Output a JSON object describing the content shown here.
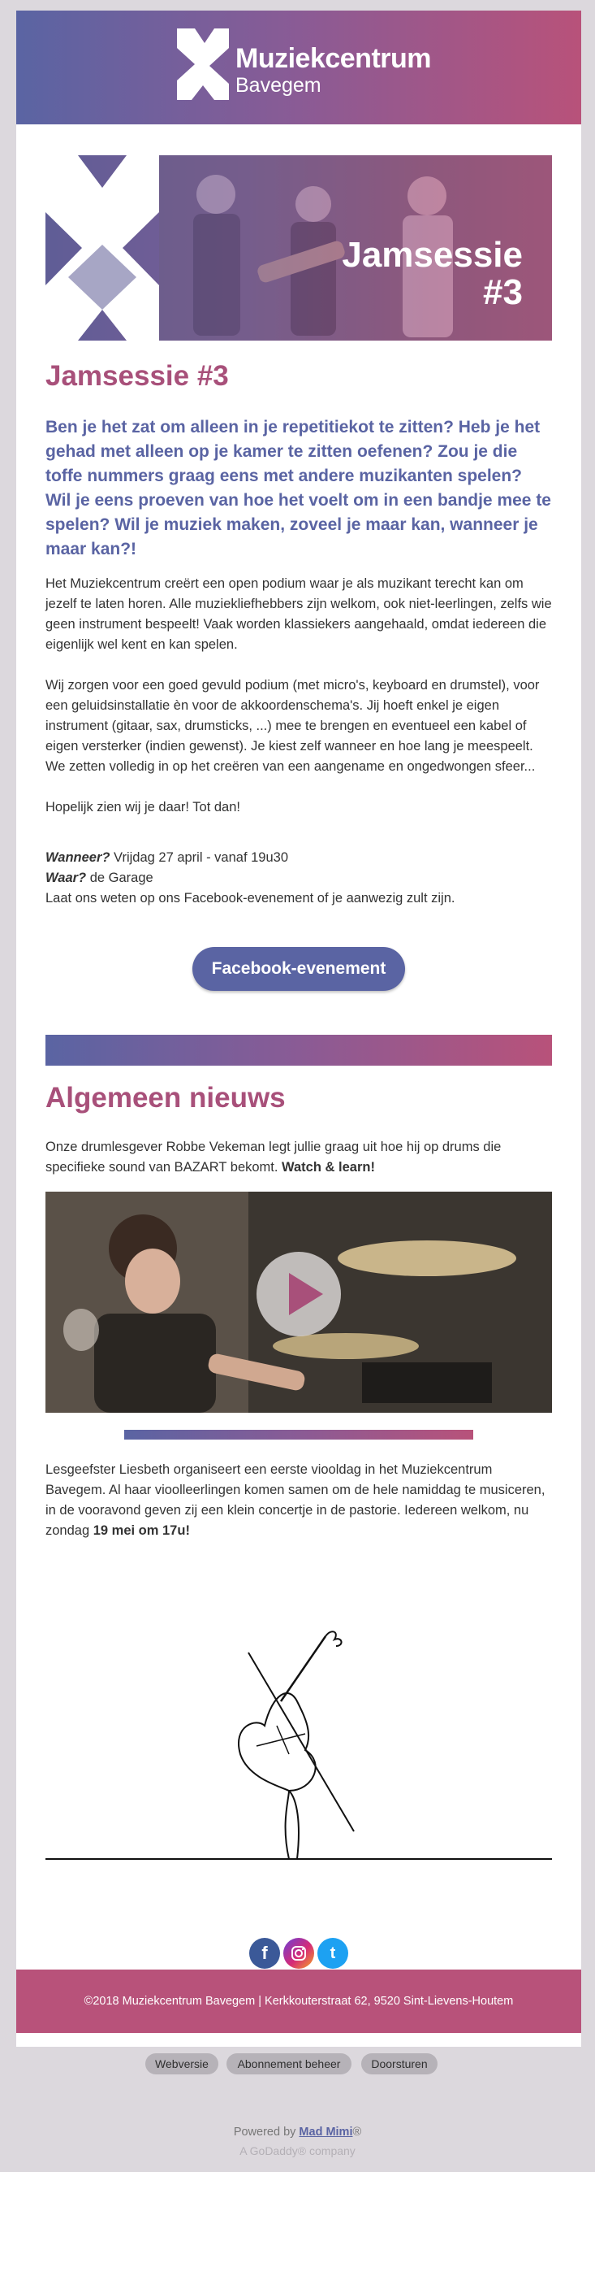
{
  "header": {
    "brand_line1": "Muziekcentrum",
    "brand_line2": "Bavegem"
  },
  "hero": {
    "title_line1": "Jamsessie",
    "title_line2": "#3"
  },
  "jam": {
    "heading": "Jamsessie #3",
    "lead": "Ben je het zat om alleen in je repetitiekot te zitten? Heb je het gehad met alleen op je kamer te zitten oefenen? Zou je die toffe nummers graag eens met andere muzikanten spelen? Wil je eens proeven van hoe het voelt om in een bandje mee te spelen? Wil je muziek maken, zoveel je maar kan, wanneer je maar kan?!",
    "para1": "Het Muziekcentrum creërt een open podium waar je als muzikant terecht kan om jezelf te laten horen. Alle muziekliefhebbers zijn welkom, ook niet-leerlingen, zelfs wie geen instrument bespeelt! Vaak worden klassiekers aangehaald, omdat iedereen die eigenlijk wel kent en kan spelen.",
    "para2": "Wij zorgen voor een goed gevuld podium (met micro's, keyboard en drumstel), voor een geluidsinstallatie èn voor de akkoordenschema's. Jij hoeft enkel je eigen instrument (gitaar, sax, drumsticks, ...) mee te brengen en eventueel een kabel of eigen versterker (indien gewenst). Je kiest zelf wanneer en hoe lang je meespeelt. We zetten volledig in op het creëren van een aangename en ongedwongen sfeer...",
    "para3": "Hopelijk zien wij je daar! Tot dan!",
    "when_label": "Wanneer?",
    "when_value": " Vrijdag 27 april - vanaf 19u30",
    "where_label": "Waar?",
    "where_value": " de Garage",
    "note": "Laat ons weten op ons Facebook-evenement of je aanwezig zult zijn.",
    "button": "Facebook-evenement"
  },
  "news": {
    "heading": "Algemeen nieuws",
    "item1_text": "Onze drumlesgever Robbe Vekeman legt jullie graag uit hoe hij op drums die specifieke sound van BAZART bekomt. ",
    "item1_bold": "Watch & learn!",
    "item2_text": "Lesgeefster Liesbeth organiseert een eerste viooldag in het Muziekcentrum Bavegem. Al haar vioolleerlingen komen samen om de hele namiddag te musiceren, in de vooravond geven zij een klein concertje in de pastorie. Iedereen welkom, nu zondag ",
    "item2_bold": "19 mei om 17u!"
  },
  "social": {
    "icons": [
      "facebook-icon",
      "instagram-icon",
      "twitter-icon"
    ],
    "facebook_glyph": "f",
    "twitter_glyph": "t"
  },
  "footer": {
    "text": "©2018 Muziekcentrum Bavegem | Kerkkouterstraat 62, 9520 Sint-Lievens-Houtem"
  },
  "links": {
    "web": "Webversie",
    "manage": "Abonnement beheer",
    "forward": "Doorsturen"
  },
  "powered": {
    "prefix": "Powered by ",
    "brand": "Mad Mimi",
    "suffix": "®",
    "company": "A GoDaddy® company"
  },
  "colors": {
    "accent_blue": "#5a64a3",
    "accent_pink": "#b8527a",
    "heading_pink": "#a8507a"
  }
}
